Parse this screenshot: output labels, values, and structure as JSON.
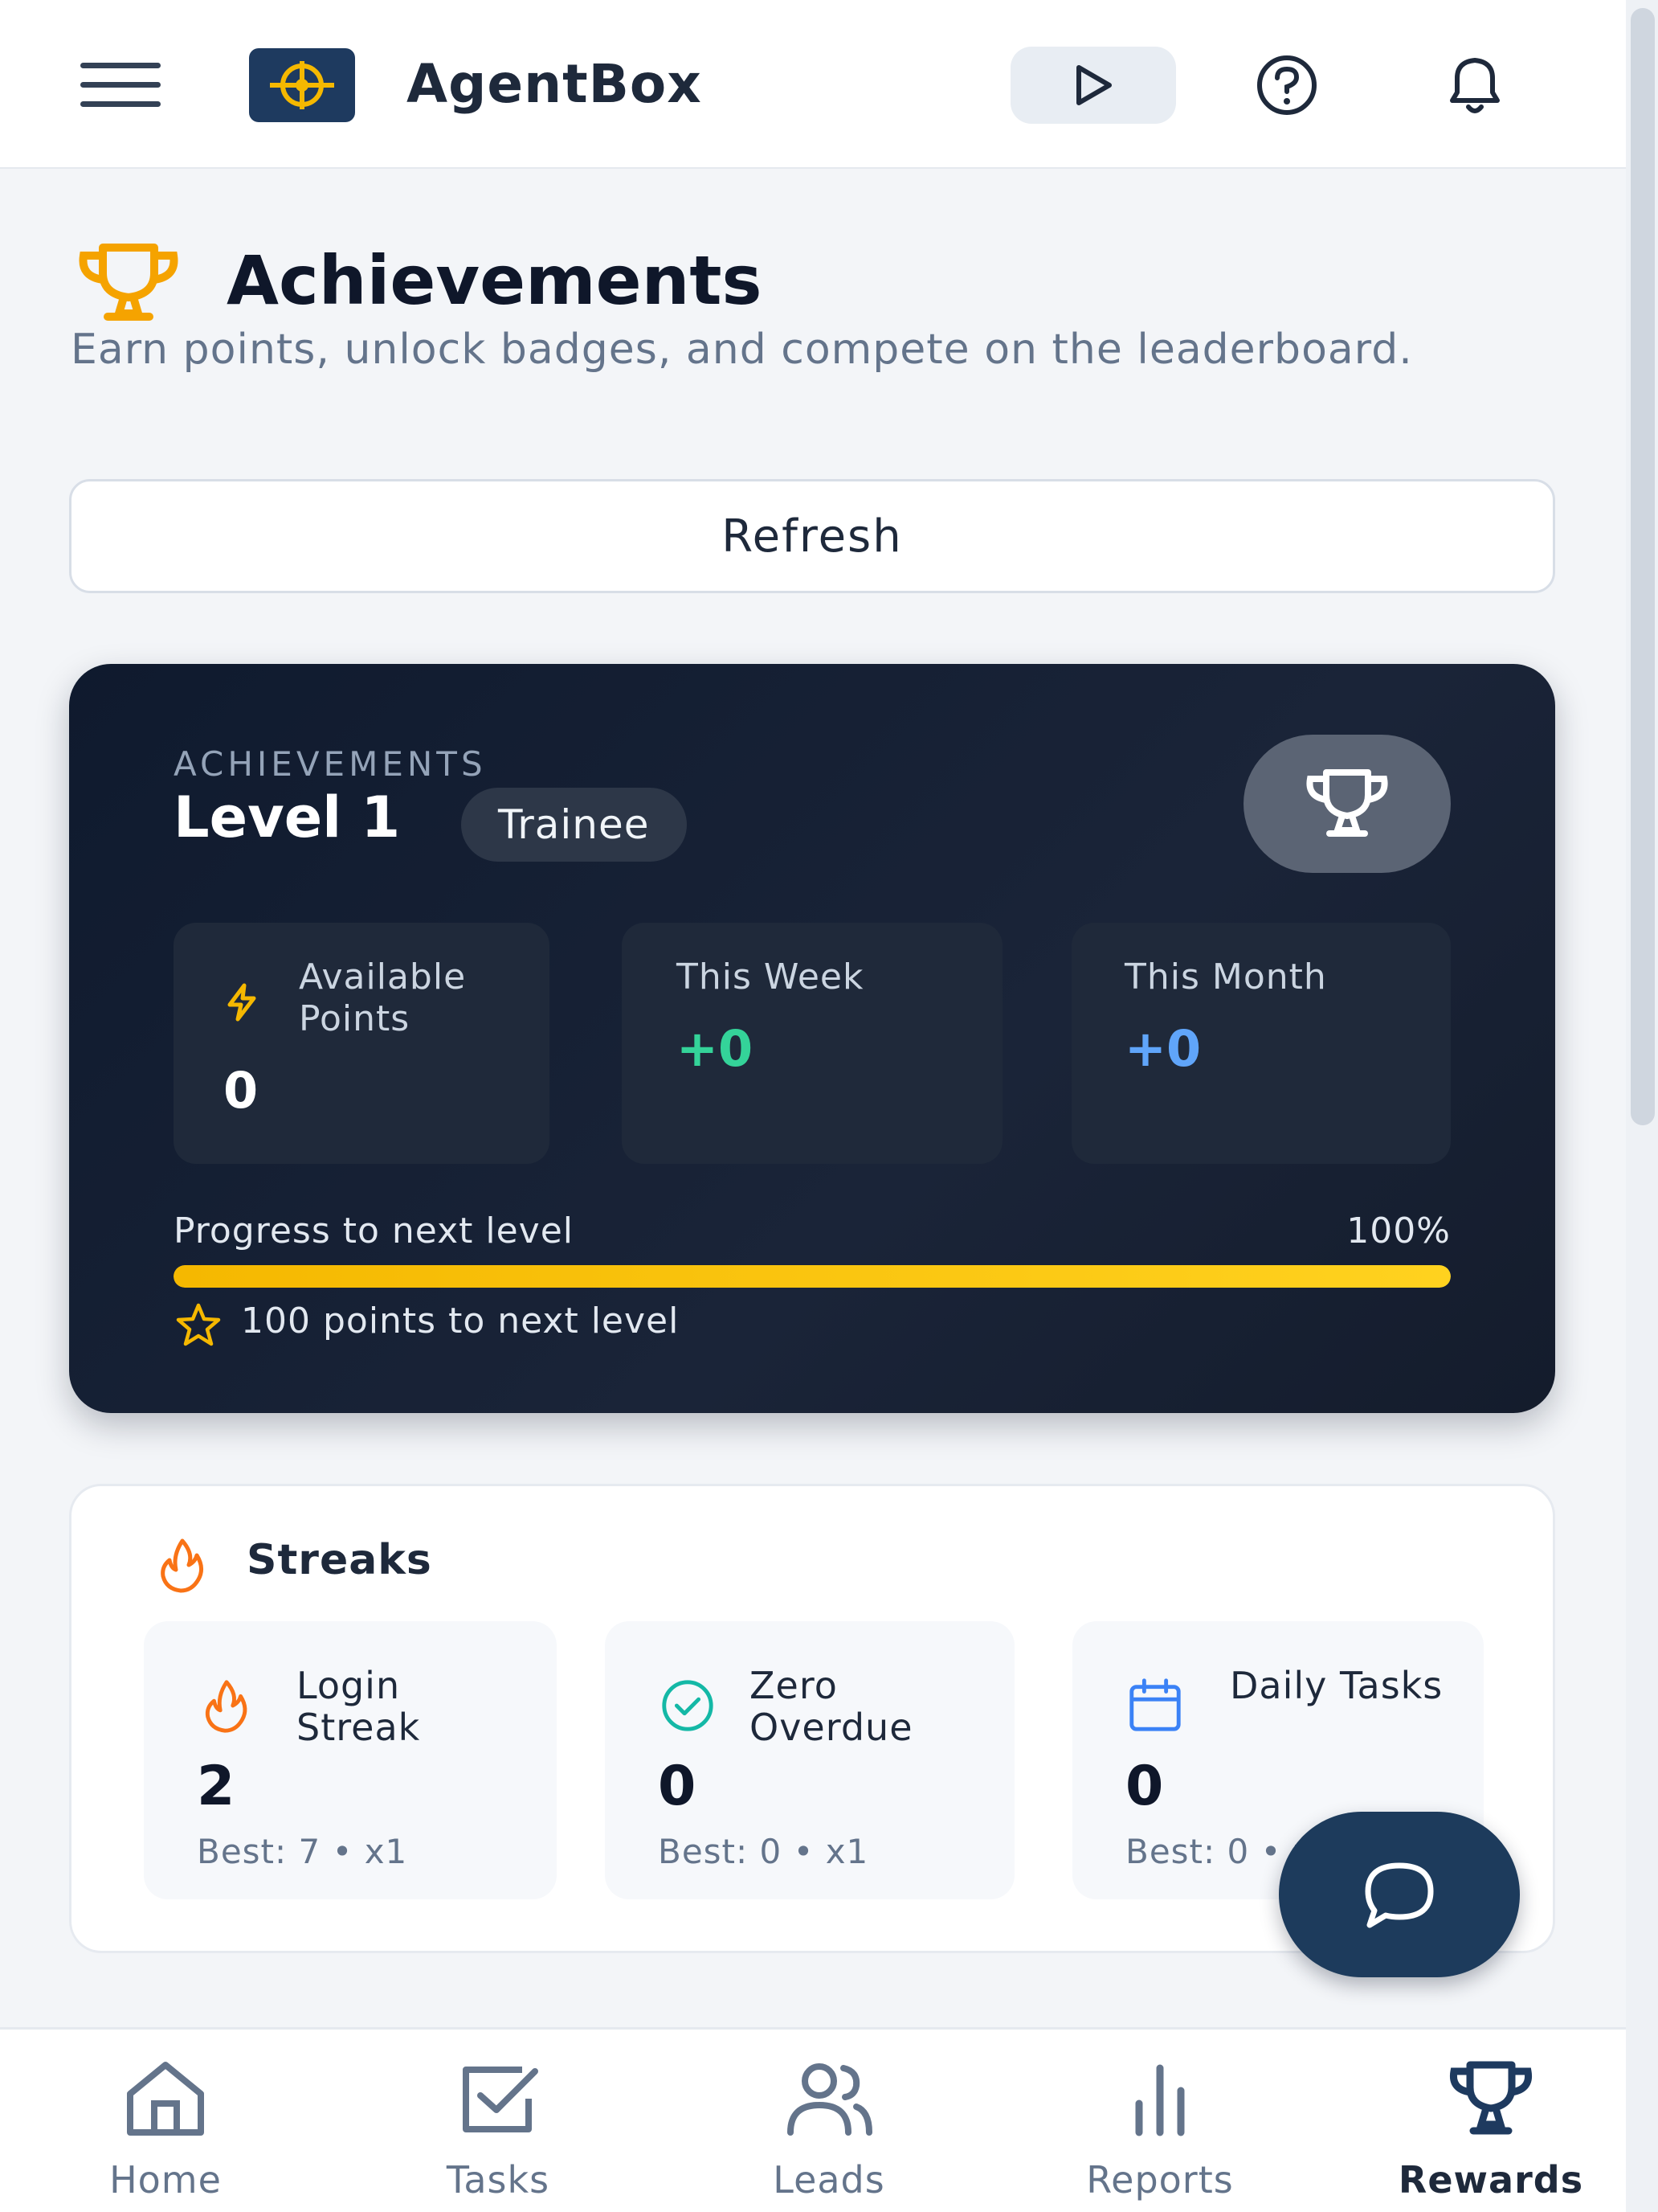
{
  "header": {
    "brand": "AgentBox",
    "icons": [
      "menu-icon",
      "logo-icon",
      "play-icon",
      "help-icon",
      "bell-icon"
    ]
  },
  "page": {
    "title": "Achievements",
    "subtitle": "Earn points, unlock badges, and compete on the leaderboard.",
    "refresh_label": "Refresh"
  },
  "level_card": {
    "kicker": "ACHIEVEMENTS",
    "level": "Level 1",
    "rank": "Trainee",
    "stats": [
      {
        "label": "Available Points",
        "value": "0",
        "color": "#ffffff"
      },
      {
        "label": "This Week",
        "value": "+0",
        "color": "#34d399"
      },
      {
        "label": "This Month",
        "value": "+0",
        "color": "#60a5fa"
      }
    ],
    "progress_label": "Progress to next level",
    "progress_pct_text": "100%",
    "progress_fraction": 1.0,
    "points_to_next": "100 points to next level",
    "accent_color": "#f5b800"
  },
  "streaks": {
    "title": "Streaks",
    "items": [
      {
        "label": "Login Streak",
        "value": "2",
        "best": "Best: 7 • x1",
        "icon": "flame-icon"
      },
      {
        "label": "Zero Overdue",
        "value": "0",
        "best": "Best: 0 • x1",
        "icon": "check-circle-icon"
      },
      {
        "label": "Daily Tasks",
        "value": "0",
        "best": "Best: 0 • x1",
        "icon": "calendar-icon"
      }
    ]
  },
  "bottom_nav": {
    "items": [
      {
        "label": "Home",
        "icon": "home-icon"
      },
      {
        "label": "Tasks",
        "icon": "tasks-icon"
      },
      {
        "label": "Leads",
        "icon": "users-icon"
      },
      {
        "label": "Reports",
        "icon": "bar-chart-icon"
      },
      {
        "label": "Rewards",
        "icon": "trophy-icon",
        "active": true
      }
    ]
  }
}
